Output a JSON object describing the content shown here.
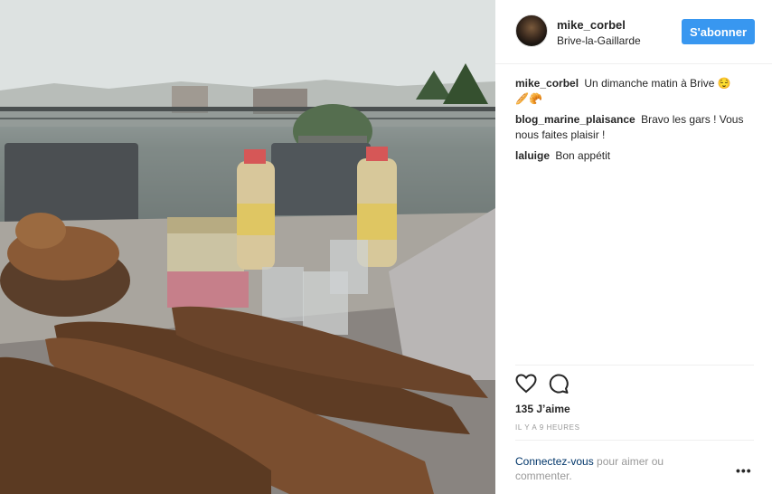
{
  "post": {
    "username": "mike_corbel",
    "location": "Brive-la-Gaillarde",
    "follow_label": "S'abonner",
    "photo_alt": "Breakfast on a balcony"
  },
  "comments": [
    {
      "author": "mike_corbel",
      "text": "Un dimanche matin à Brive 😌",
      "text2": "🥖🥐"
    },
    {
      "author": "blog_marine_plaisance",
      "text": "Bravo les gars ! Vous nous faites plaisir !"
    },
    {
      "author": "laluige",
      "text": "Bon appétit"
    }
  ],
  "stats": {
    "likes": "135 J’aime",
    "time_ago": "IL Y A 9 HEURES"
  },
  "login_prompt": {
    "link": "Connectez-vous",
    "text": " pour aimer ou commenter."
  },
  "more_label": "•••",
  "icons": {
    "like": "heart-outline-icon",
    "comment": "speech-bubble-icon",
    "more": "ellipsis-icon"
  },
  "colors": {
    "follow_button": "#3897f0",
    "link": "#003569",
    "muted": "#999999"
  }
}
